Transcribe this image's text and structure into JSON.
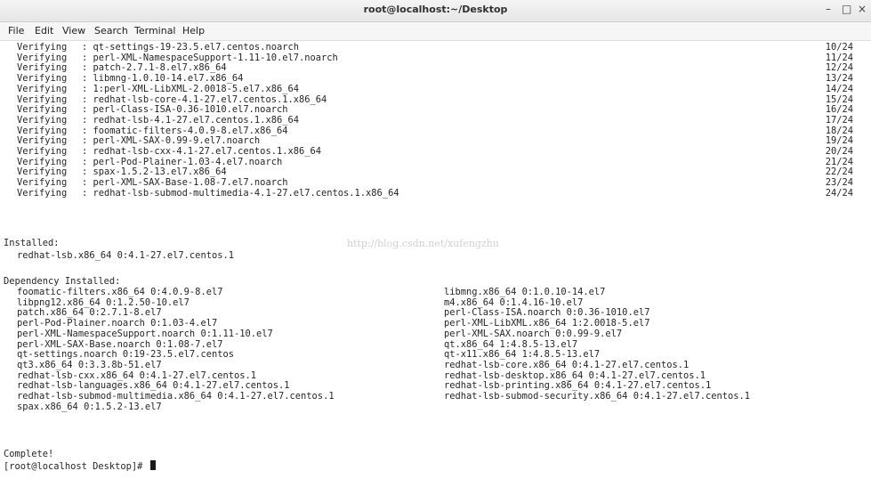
{
  "window": {
    "title": "root@localhost:~/Desktop",
    "minimize_glyph": "–",
    "maximize_glyph": "□",
    "close_glyph": "×"
  },
  "menu": [
    "File",
    "Edit",
    "View",
    "Search",
    "Terminal",
    "Help"
  ],
  "verifying": [
    {
      "label": "Verifying",
      "pkg": ": qt-settings-19-23.5.el7.centos.noarch",
      "count": "10/24"
    },
    {
      "label": "Verifying",
      "pkg": ": perl-XML-NamespaceSupport-1.11-10.el7.noarch",
      "count": "11/24"
    },
    {
      "label": "Verifying",
      "pkg": ": patch-2.7.1-8.el7.x86_64",
      "count": "12/24"
    },
    {
      "label": "Verifying",
      "pkg": ": libmng-1.0.10-14.el7.x86_64",
      "count": "13/24"
    },
    {
      "label": "Verifying",
      "pkg": ": 1:perl-XML-LibXML-2.0018-5.el7.x86_64",
      "count": "14/24"
    },
    {
      "label": "Verifying",
      "pkg": ": redhat-lsb-core-4.1-27.el7.centos.1.x86_64",
      "count": "15/24"
    },
    {
      "label": "Verifying",
      "pkg": ": perl-Class-ISA-0.36-1010.el7.noarch",
      "count": "16/24"
    },
    {
      "label": "Verifying",
      "pkg": ": redhat-lsb-4.1-27.el7.centos.1.x86_64",
      "count": "17/24"
    },
    {
      "label": "Verifying",
      "pkg": ": foomatic-filters-4.0.9-8.el7.x86_64",
      "count": "18/24"
    },
    {
      "label": "Verifying",
      "pkg": ": perl-XML-SAX-0.99-9.el7.noarch",
      "count": "19/24"
    },
    {
      "label": "Verifying",
      "pkg": ": redhat-lsb-cxx-4.1-27.el7.centos.1.x86_64",
      "count": "20/24"
    },
    {
      "label": "Verifying",
      "pkg": ": perl-Pod-Plainer-1.03-4.el7.noarch",
      "count": "21/24"
    },
    {
      "label": "Verifying",
      "pkg": ": spax-1.5.2-13.el7.x86_64",
      "count": "22/24"
    },
    {
      "label": "Verifying",
      "pkg": ": perl-XML-SAX-Base-1.08-7.el7.noarch",
      "count": "23/24"
    },
    {
      "label": "Verifying",
      "pkg": ": redhat-lsb-submod-multimedia-4.1-27.el7.centos.1.x86_64",
      "count": "24/24"
    }
  ],
  "installed": {
    "header": "Installed:",
    "items": [
      "redhat-lsb.x86_64 0:4.1-27.el7.centos.1"
    ]
  },
  "watermark": "http://blog.csdn.net/xufengzhu",
  "dependency": {
    "header": "Dependency Installed:",
    "left": [
      "foomatic-filters.x86_64 0:4.0.9-8.el7",
      "libpng12.x86_64 0:1.2.50-10.el7",
      "patch.x86_64 0:2.7.1-8.el7",
      "perl-Pod-Plainer.noarch 0:1.03-4.el7",
      "perl-XML-NamespaceSupport.noarch 0:1.11-10.el7",
      "perl-XML-SAX-Base.noarch 0:1.08-7.el7",
      "qt-settings.noarch 0:19-23.5.el7.centos",
      "qt3.x86_64 0:3.3.8b-51.el7",
      "redhat-lsb-cxx.x86_64 0:4.1-27.el7.centos.1",
      "redhat-lsb-languages.x86_64 0:4.1-27.el7.centos.1",
      "redhat-lsb-submod-multimedia.x86_64 0:4.1-27.el7.centos.1",
      "spax.x86_64 0:1.5.2-13.el7"
    ],
    "right": [
      "libmng.x86_64 0:1.0.10-14.el7",
      "m4.x86_64 0:1.4.16-10.el7",
      "perl-Class-ISA.noarch 0:0.36-1010.el7",
      "perl-XML-LibXML.x86_64 1:2.0018-5.el7",
      "perl-XML-SAX.noarch 0:0.99-9.el7",
      "qt.x86_64 1:4.8.5-13.el7",
      "qt-x11.x86_64 1:4.8.5-13.el7",
      "redhat-lsb-core.x86_64 0:4.1-27.el7.centos.1",
      "redhat-lsb-desktop.x86_64 0:4.1-27.el7.centos.1",
      "redhat-lsb-printing.x86_64 0:4.1-27.el7.centos.1",
      "redhat-lsb-submod-security.x86_64 0:4.1-27.el7.centos.1"
    ]
  },
  "complete": "Complete!",
  "prompt": "[root@localhost Desktop]# "
}
